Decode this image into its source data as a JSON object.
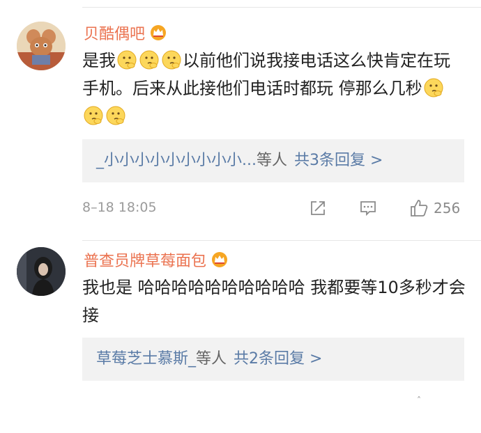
{
  "comments": [
    {
      "username": "贝酷偶吧",
      "badge_icon": "crown-vip-icon",
      "text_part1": "是我",
      "text_part2": "以前他们说我接电话这么快肯定在玩手机。后来从此接他们电话时都玩 停那么几秒",
      "emoji_icon": "thinking-face-emoji",
      "replies": {
        "names": "_小小小小小小小小小...",
        "others": "等人",
        "count": "共3条回复 >"
      },
      "timestamp": "8–18 18:05",
      "likes": "256"
    },
    {
      "username": "普查员牌草莓面包",
      "badge_icon": "crown-vip-icon",
      "text": "我也是 哈哈哈哈哈哈哈哈哈哈 我都要等10多秒才会接",
      "replies": {
        "names": "草莓芝士慕斯_",
        "others": "等人",
        "count": "共2条回复 >"
      }
    }
  ],
  "colors": {
    "username": "#eb7350",
    "link": "#5a7ba6",
    "reply_bg": "#f2f2f2",
    "meta": "#9b9b9b"
  }
}
